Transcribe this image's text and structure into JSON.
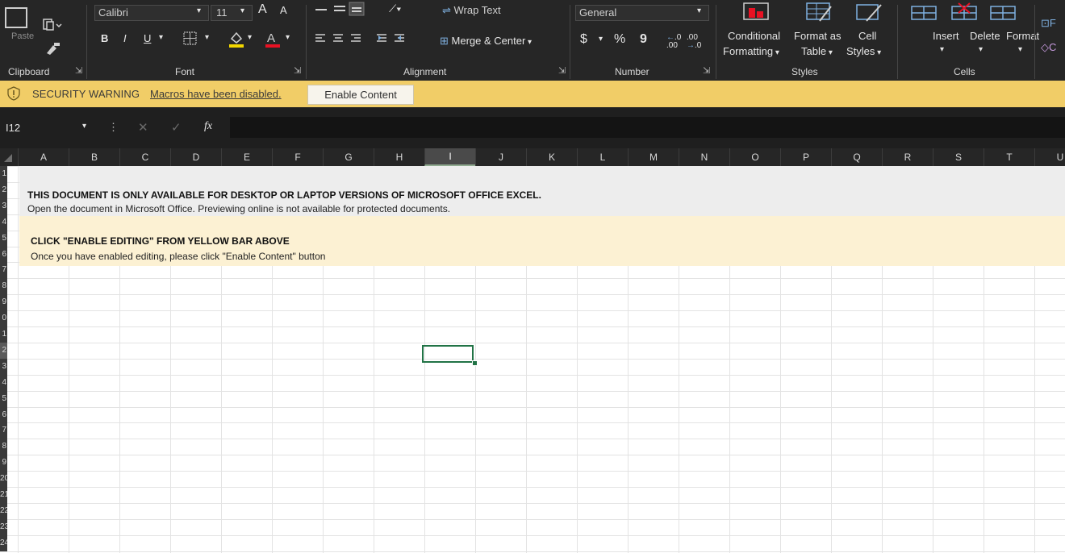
{
  "ribbon": {
    "clipboard": {
      "paste_label": "Paste",
      "group": "Clipboard"
    },
    "font": {
      "font_name": "Calibri",
      "font_size": "11",
      "group": "Font",
      "bold": "B",
      "italic": "I",
      "underline": "U",
      "grow": "A",
      "shrink": "A",
      "fill_color": "#f2d600",
      "font_color": "#e81123"
    },
    "alignment": {
      "wrap_text": "Wrap Text",
      "merge_center": "Merge & Center",
      "group": "Alignment"
    },
    "number": {
      "format": "General",
      "currency": "$",
      "percent": "%",
      "comma": "9",
      "group": "Number"
    },
    "styles": {
      "conditional_line1": "Conditional",
      "conditional_line2": "Formatting",
      "format_as_line1": "Format as",
      "format_as_line2": "Table",
      "cell_styles_line1": "Cell",
      "cell_styles_line2": "Styles",
      "group": "Styles"
    },
    "cells": {
      "insert": "Insert",
      "delete": "Delete",
      "format": "Format",
      "group": "Cells"
    }
  },
  "security_bar": {
    "title": "SECURITY WARNING",
    "message": "Macros have been disabled.",
    "button": "Enable Content",
    "color": "#f1cd67"
  },
  "formula_bar": {
    "name_box": "I12",
    "fx": "fx",
    "value": ""
  },
  "columns": [
    "A",
    "B",
    "C",
    "D",
    "E",
    "F",
    "G",
    "H",
    "I",
    "J",
    "K",
    "L",
    "M",
    "N",
    "O",
    "P",
    "Q",
    "R",
    "S",
    "T",
    "U"
  ],
  "selected_column": "I",
  "rows": [
    "1",
    "2",
    "3",
    "4",
    "5",
    "6",
    "7",
    "8",
    "9",
    "0",
    "1",
    "2",
    "3",
    "4",
    "5",
    "6",
    "7",
    "8",
    "9",
    "20",
    "21",
    "22",
    "23",
    "24"
  ],
  "selected_row": "2",
  "sheet": {
    "notice1_title": "THIS DOCUMENT IS ONLY AVAILABLE FOR DESKTOP OR LAPTOP VERSIONS OF MICROSOFT OFFICE EXCEL.",
    "notice1_text": "Open the document in Microsoft Office. Previewing online is not available for protected documents.",
    "notice2_title": "CLICK \"ENABLE EDITING\" FROM YELLOW BAR ABOVE",
    "notice2_text": "Once you have enabled editing, please click \"Enable Content\" button",
    "notice2_color": "#fcf1d3",
    "selected_cell": "I12",
    "selection_color": "#217346"
  }
}
